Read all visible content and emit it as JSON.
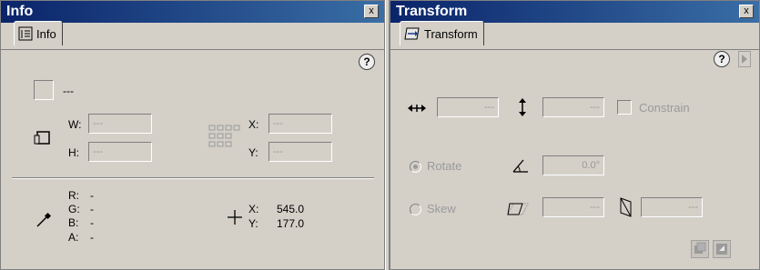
{
  "info_panel": {
    "title": "Info",
    "close": "x",
    "tab_label": "Info",
    "help": "?",
    "fill_value": "---",
    "w_label": "W:",
    "w_value": "---",
    "h_label": "H:",
    "h_value": "---",
    "x_label": "X:",
    "x_value": "---",
    "y_label": "Y:",
    "y_value": "---",
    "r_label": "R:",
    "r_value": "-",
    "g_label": "G:",
    "g_value": "-",
    "b_label": "B:",
    "b_value": "-",
    "a_label": "A:",
    "a_value": "-",
    "cursor_x_label": "X:",
    "cursor_x_value": "545.0",
    "cursor_y_label": "Y:",
    "cursor_y_value": "177.0"
  },
  "transform_panel": {
    "title": "Transform",
    "close": "x",
    "tab_label": "Transform",
    "help": "?",
    "width_value": "---",
    "height_value": "---",
    "constrain_label": "Constrain",
    "rotate_label": "Rotate",
    "rotate_value": "0.0°",
    "skew_label": "Skew",
    "skew_h_value": "---",
    "skew_v_value": "---"
  }
}
